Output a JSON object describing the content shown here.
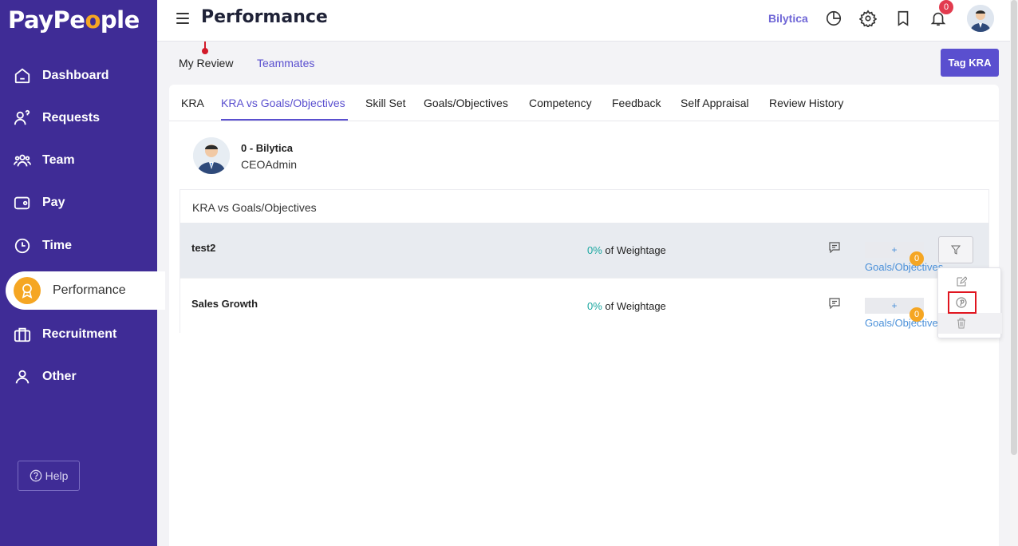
{
  "brand": {
    "logo_part1": "PayPe",
    "logo_o": "o",
    "logo_part2": "ple"
  },
  "sidebar": {
    "items": [
      {
        "label": "Dashboard",
        "icon": "home-icon"
      },
      {
        "label": "Requests",
        "icon": "user-question-icon"
      },
      {
        "label": "Team",
        "icon": "team-icon"
      },
      {
        "label": "Pay",
        "icon": "wallet-icon"
      },
      {
        "label": "Time",
        "icon": "clock-icon"
      },
      {
        "label": "Performance",
        "icon": "award-icon",
        "active": true
      },
      {
        "label": "Recruitment",
        "icon": "briefcase-icon"
      },
      {
        "label": "Other",
        "icon": "user-icon"
      }
    ],
    "help_label": "Help"
  },
  "header": {
    "title": "Performance",
    "company": "Bilytica",
    "notification_count": "0"
  },
  "subtabs": {
    "my_review": "My Review",
    "teammates": "Teammates",
    "tag_kra": "Tag KRA"
  },
  "tabs": [
    "KRA",
    "KRA vs Goals/Objectives",
    "Skill Set",
    "Goals/Objectives",
    "Competency",
    "Feedback",
    "Self Appraisal",
    "Review History"
  ],
  "active_tab": "KRA vs Goals/Objectives",
  "employee": {
    "name": "0 - Bilytica",
    "role": "CEOAdmin"
  },
  "panel": {
    "title": "KRA vs Goals/Objectives",
    "rows": [
      {
        "name": "test2",
        "pct": "0%",
        "weight_label": "of Weightage",
        "add": "+",
        "goals_label": "Goals/Objectives",
        "count": "0"
      },
      {
        "name": "Sales Growth",
        "pct": "0%",
        "weight_label": "of Weightage",
        "add": "+",
        "goals_label": "Goals/Objectives",
        "count": "0"
      }
    ]
  },
  "dropdown": [
    "edit-icon",
    "pinterest-icon",
    "trash-icon"
  ],
  "colors": {
    "sidebar": "#3f2c96",
    "accent": "#5a4fcf",
    "orange": "#f5a623",
    "teal": "#1aa7a0",
    "link": "#4a90d9"
  }
}
